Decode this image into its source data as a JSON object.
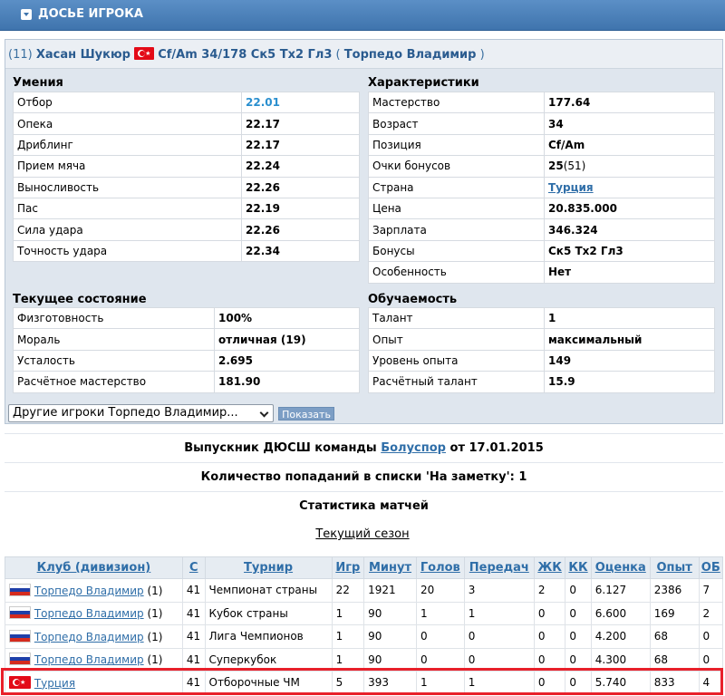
{
  "header": {
    "title": "ДОСЬЕ ИГРОКА",
    "icon": "collapse-icon"
  },
  "player": {
    "number": "(11)",
    "name": "Хасан Шукюр",
    "flag_icon": "turkey-flag-icon",
    "info": "Cf/Am 34/178 Ск5 Тх2 Гл3",
    "team_open": "(",
    "team": "Торпедо Владимир",
    "team_close": ")"
  },
  "skills": {
    "heading": "Умения",
    "rows": [
      {
        "label": "Отбор",
        "value": "22.01"
      },
      {
        "label": "Опека",
        "value": "22.17"
      },
      {
        "label": "Дриблинг",
        "value": "22.17"
      },
      {
        "label": "Прием мяча",
        "value": "22.24"
      },
      {
        "label": "Выносливость",
        "value": "22.26"
      },
      {
        "label": "Пас",
        "value": "22.19"
      },
      {
        "label": "Сила удара",
        "value": "22.26"
      },
      {
        "label": "Точность удара",
        "value": "22.34"
      }
    ]
  },
  "characteristics": {
    "heading": "Характеристики",
    "rows": [
      {
        "label": "Мастерство",
        "value": "177.64"
      },
      {
        "label": "Возраст",
        "value": "34"
      },
      {
        "label": "Позиция",
        "value": "Cf/Am"
      },
      {
        "label": "Очки бонусов",
        "value": "25",
        "extra": "(51)"
      },
      {
        "label": "Страна",
        "value": "Турция"
      },
      {
        "label": "Цена",
        "value": "20.835.000"
      },
      {
        "label": "Зарплата",
        "value": "346.324"
      },
      {
        "label": "Бонусы",
        "value": "Ск5 Тх2 Гл3"
      },
      {
        "label": "Особенность",
        "value": "Нет"
      }
    ]
  },
  "condition": {
    "heading": "Текущее состояние",
    "rows": [
      {
        "label": "Физготовность",
        "value": "100%"
      },
      {
        "label": "Мораль",
        "value": "отличная (19)"
      },
      {
        "label": "Усталость",
        "value": "2.695"
      },
      {
        "label": "Расчётное мастерство",
        "value": "181.90"
      }
    ]
  },
  "learning": {
    "heading": "Обучаемость",
    "rows": [
      {
        "label": "Талант",
        "value": "1"
      },
      {
        "label": "Опыт",
        "value": "максимальный"
      },
      {
        "label": "Уровень опыта",
        "value": "149"
      },
      {
        "label": "Расчётный талант",
        "value": "15.9"
      }
    ]
  },
  "other_players": {
    "selected": "Другие игроки Торпедо Владимир...",
    "button": "Показать"
  },
  "graduate": {
    "prefix": "Выпускник ДЮСШ команды",
    "team": "Болуспор",
    "suffix": "от 17.01.2015"
  },
  "watchlist": "Количество попаданий в списки 'На заметку': 1",
  "stats_title": "Статистика матчей",
  "season_link": "Текущий сезон",
  "stats": {
    "columns": [
      "Клуб (дивизион)",
      "С",
      "Турнир",
      "Игр",
      "Минут",
      "Голов",
      "Передач",
      "ЖК",
      "КК",
      "Оценка",
      "Опыт",
      "ОБ"
    ],
    "rows": [
      {
        "flag": "russia-flag-icon",
        "club": "Торпедо Владимир",
        "div": "(1)",
        "s": "41",
        "tournament": "Чемпионат страны",
        "games": "22",
        "minutes": "1921",
        "goals": "20",
        "assists": "3",
        "yc": "2",
        "rc": "0",
        "rating": "6.127",
        "exp": "2386",
        "ob": "7"
      },
      {
        "flag": "russia-flag-icon",
        "club": "Торпедо Владимир",
        "div": "(1)",
        "s": "41",
        "tournament": "Кубок страны",
        "games": "1",
        "minutes": "90",
        "goals": "1",
        "assists": "1",
        "yc": "0",
        "rc": "0",
        "rating": "6.600",
        "exp": "169",
        "ob": "2"
      },
      {
        "flag": "russia-flag-icon",
        "club": "Торпедо Владимир",
        "div": "(1)",
        "s": "41",
        "tournament": "Лига Чемпионов",
        "games": "1",
        "minutes": "90",
        "goals": "0",
        "assists": "0",
        "yc": "0",
        "rc": "0",
        "rating": "4.200",
        "exp": "68",
        "ob": "0"
      },
      {
        "flag": "russia-flag-icon",
        "club": "Торпедо Владимир",
        "div": "(1)",
        "s": "41",
        "tournament": "Суперкубок",
        "games": "1",
        "minutes": "90",
        "goals": "0",
        "assists": "0",
        "yc": "0",
        "rc": "0",
        "rating": "4.300",
        "exp": "68",
        "ob": "0"
      },
      {
        "flag": "turkey-flag-icon",
        "club": "Турция",
        "div": "",
        "s": "41",
        "tournament": "Отборочные ЧМ",
        "games": "5",
        "minutes": "393",
        "goals": "1",
        "assists": "1",
        "yc": "0",
        "rc": "0",
        "rating": "5.740",
        "exp": "833",
        "ob": "4"
      }
    ]
  },
  "colors": {
    "header": "#4a80ba",
    "link": "#2f6ea8",
    "highlight": "#e8202a",
    "accent_value": "#2a8fcf"
  }
}
